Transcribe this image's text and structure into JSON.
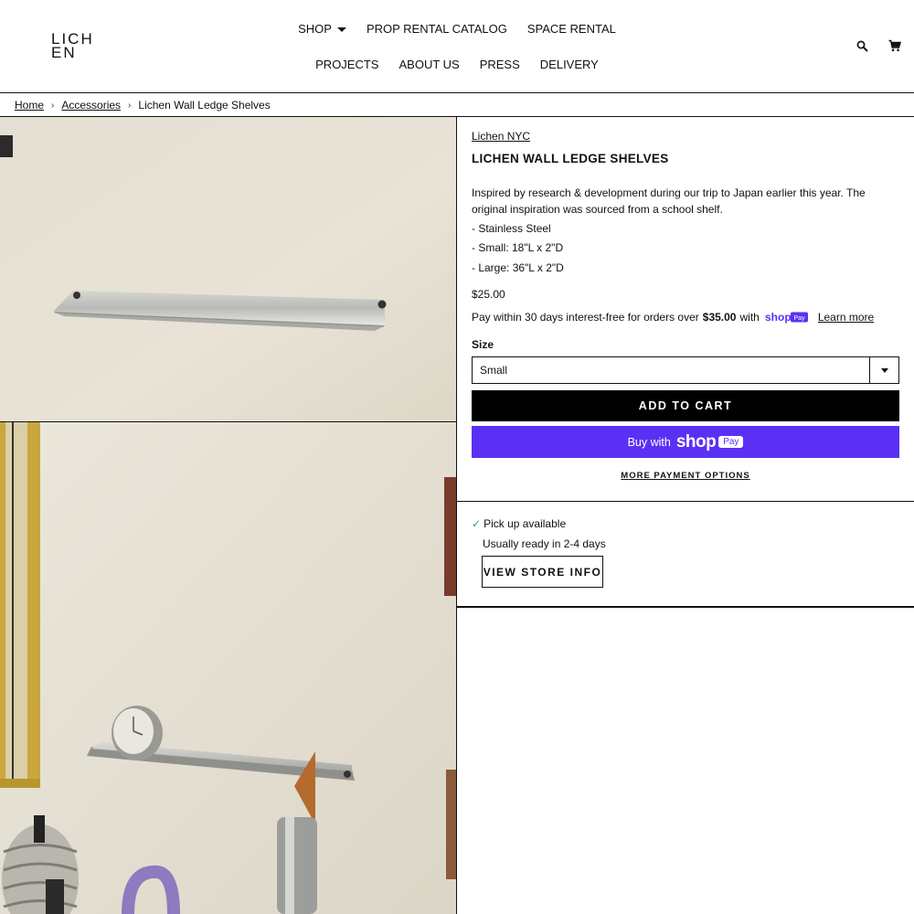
{
  "header": {
    "logo_line1": "LICH",
    "logo_line2": "EN",
    "nav_row1": [
      "SHOP",
      "PROP RENTAL CATALOG",
      "SPACE RENTAL"
    ],
    "nav_row2": [
      "PROJECTS",
      "ABOUT US",
      "PRESS",
      "DELIVERY"
    ],
    "icons": [
      "search-icon",
      "cart-icon"
    ]
  },
  "breadcrumb": {
    "items": [
      "Home",
      "Accessories",
      "Lichen Wall Ledge Shelves"
    ],
    "separator": "›"
  },
  "product": {
    "vendor": "Lichen NYC",
    "title": "LICHEN WALL LEDGE SHELVES",
    "description": "Inspired by research & development during our trip to Japan earlier this year. The original inspiration was sourced from a school shelf.",
    "bullets": [
      "- Stainless Steel",
      "- Small: 18\"L x 2\"D",
      "- Large: 36\"L x 2\"D"
    ],
    "price": "$25.00",
    "installments": {
      "prefix": "Pay within 30 days interest-free for orders over",
      "threshold": "$35.00",
      "with": "with",
      "learn_more": "Learn more"
    },
    "size_label": "Size",
    "size_selected": "Small",
    "add_to_cart": "ADD TO CART",
    "buy_with": "Buy with",
    "more_payment": "MORE PAYMENT OPTIONS",
    "shop_brand": "shop",
    "pay_badge": "Pay"
  },
  "pickup": {
    "available": "Pick up available",
    "ready": "Usually ready in 2-4 days",
    "store_button": "VIEW STORE INFO"
  },
  "colors": {
    "shop_pay_purple": "#5a31f4",
    "check_green": "#3aa558",
    "button_black": "#000000"
  }
}
